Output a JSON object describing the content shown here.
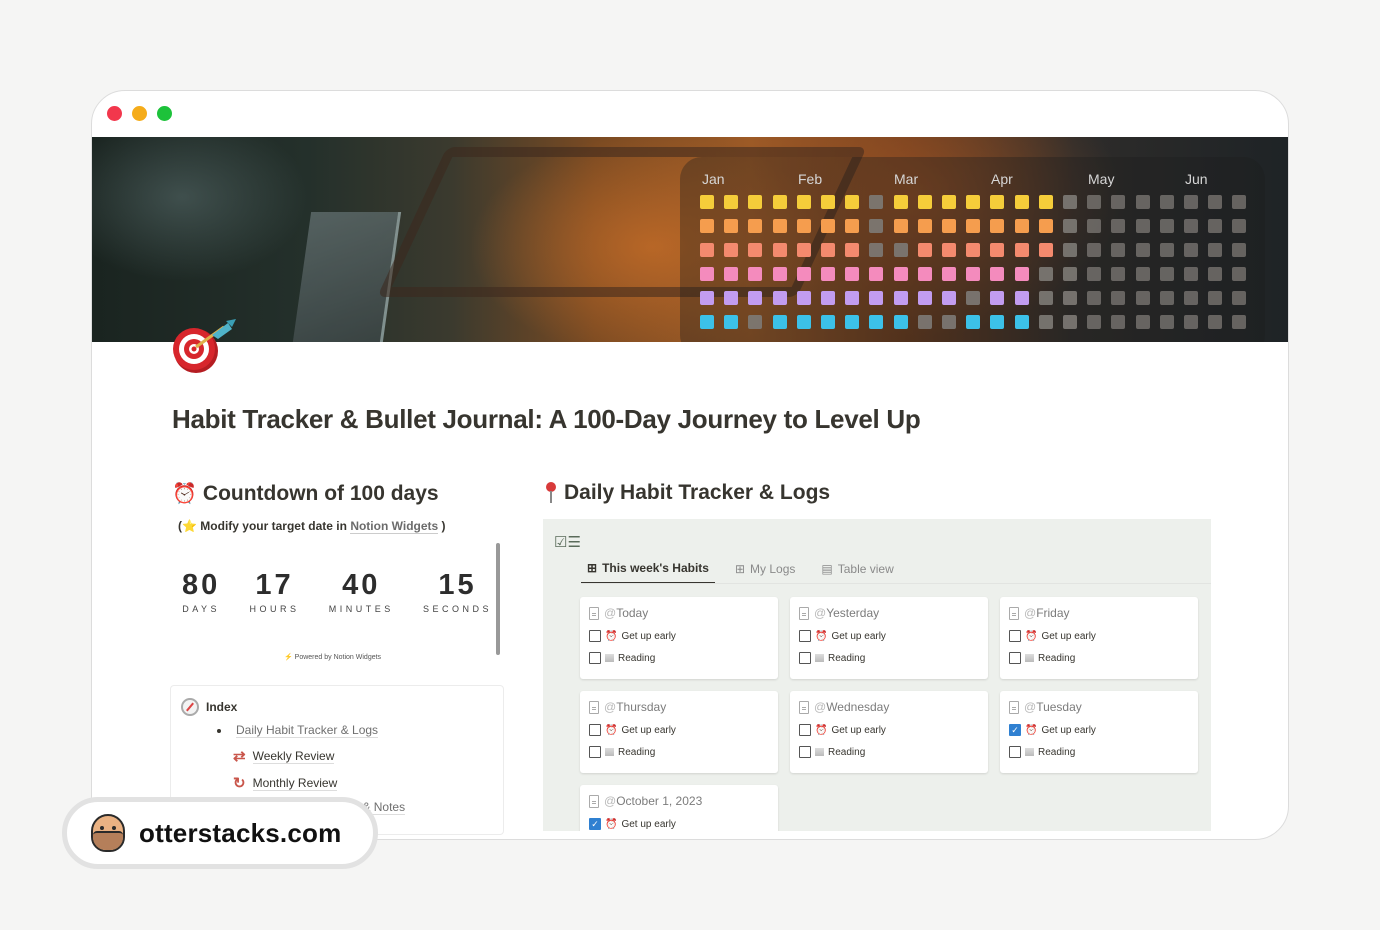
{
  "window": {
    "controls": [
      "close",
      "minimize",
      "maximize"
    ]
  },
  "cover": {
    "months": [
      "Jan",
      "Feb",
      "Mar",
      "Apr",
      "May",
      "Jun"
    ],
    "row_colors": [
      "#f5cd3a",
      "#f59d4e",
      "#f48a6e",
      "#f48bbd",
      "#c29cf0",
      "#3cc1e8"
    ],
    "off_color": "#7d7a75",
    "heatmap_rows": [
      [
        1,
        1,
        1,
        1,
        1,
        1,
        1,
        0,
        1,
        1,
        1,
        1,
        1,
        1,
        1,
        0,
        0,
        0,
        0,
        0,
        0,
        0,
        0
      ],
      [
        1,
        1,
        1,
        1,
        1,
        1,
        1,
        0,
        1,
        1,
        1,
        1,
        1,
        1,
        1,
        0,
        0,
        0,
        0,
        0,
        0,
        0,
        0
      ],
      [
        1,
        1,
        1,
        1,
        1,
        1,
        1,
        0,
        0,
        1,
        1,
        1,
        1,
        1,
        1,
        0,
        0,
        0,
        0,
        0,
        0,
        0,
        0
      ],
      [
        1,
        1,
        1,
        1,
        1,
        1,
        1,
        1,
        1,
        1,
        1,
        1,
        1,
        1,
        0,
        0,
        0,
        0,
        0,
        0,
        0,
        0,
        0
      ],
      [
        1,
        1,
        1,
        1,
        1,
        1,
        1,
        1,
        1,
        1,
        1,
        0,
        1,
        1,
        0,
        0,
        0,
        0,
        0,
        0,
        0,
        0,
        0
      ],
      [
        1,
        1,
        0,
        1,
        1,
        1,
        1,
        1,
        1,
        0,
        0,
        1,
        1,
        1,
        0,
        0,
        0,
        0,
        0,
        0,
        0,
        0,
        0
      ]
    ]
  },
  "page": {
    "icon": "dart-target-icon",
    "title": "Habit Tracker & Bullet Journal: A 100-Day Journey to Level Up"
  },
  "countdown": {
    "heading": "Countdown of 100 days",
    "sub_prefix": "(",
    "sub_star": "⭐",
    "sub_text": " Modify your target date in ",
    "sub_link": "Notion Widgets",
    "sub_suffix": " )",
    "units": [
      {
        "value": "80",
        "label": "DAYS"
      },
      {
        "value": "17",
        "label": "HOURS"
      },
      {
        "value": "40",
        "label": "MINUTES"
      },
      {
        "value": "15",
        "label": "SECONDS"
      }
    ],
    "powered": "Powered by Notion Widgets"
  },
  "index": {
    "title": "Index",
    "items": [
      {
        "label": "Daily Habit Tracker & Logs"
      },
      {
        "label": "Weekly Review"
      },
      {
        "label": "Monthly Review"
      },
      {
        "label": "My Reading Collections & Notes"
      }
    ]
  },
  "tracker": {
    "heading": "Daily Habit Tracker & Logs",
    "tabs": [
      {
        "label": "This week's Habits",
        "active": true
      },
      {
        "label": "My Logs",
        "active": false
      },
      {
        "label": "Table view",
        "active": false
      }
    ],
    "cards": [
      {
        "title": "Today",
        "habits": [
          {
            "label": "Get up early",
            "checked": false
          },
          {
            "label": "Reading",
            "checked": false
          }
        ]
      },
      {
        "title": "Yesterday",
        "habits": [
          {
            "label": "Get up early",
            "checked": false
          },
          {
            "label": "Reading",
            "checked": false
          }
        ]
      },
      {
        "title": "Friday",
        "habits": [
          {
            "label": "Get up early",
            "checked": false
          },
          {
            "label": "Reading",
            "checked": false
          }
        ]
      },
      {
        "title": "Thursday",
        "habits": [
          {
            "label": "Get up early",
            "checked": false
          },
          {
            "label": "Reading",
            "checked": false
          }
        ]
      },
      {
        "title": "Wednesday",
        "habits": [
          {
            "label": "Get up early",
            "checked": false
          },
          {
            "label": "Reading",
            "checked": false
          }
        ]
      },
      {
        "title": "Tuesday",
        "habits": [
          {
            "label": "Get up early",
            "checked": true
          },
          {
            "label": "Reading",
            "checked": false
          }
        ]
      },
      {
        "title": "October 1, 2023",
        "habits": [
          {
            "label": "Get up early",
            "checked": true
          }
        ]
      }
    ]
  },
  "watermark": {
    "text": "otterstacks.com"
  }
}
